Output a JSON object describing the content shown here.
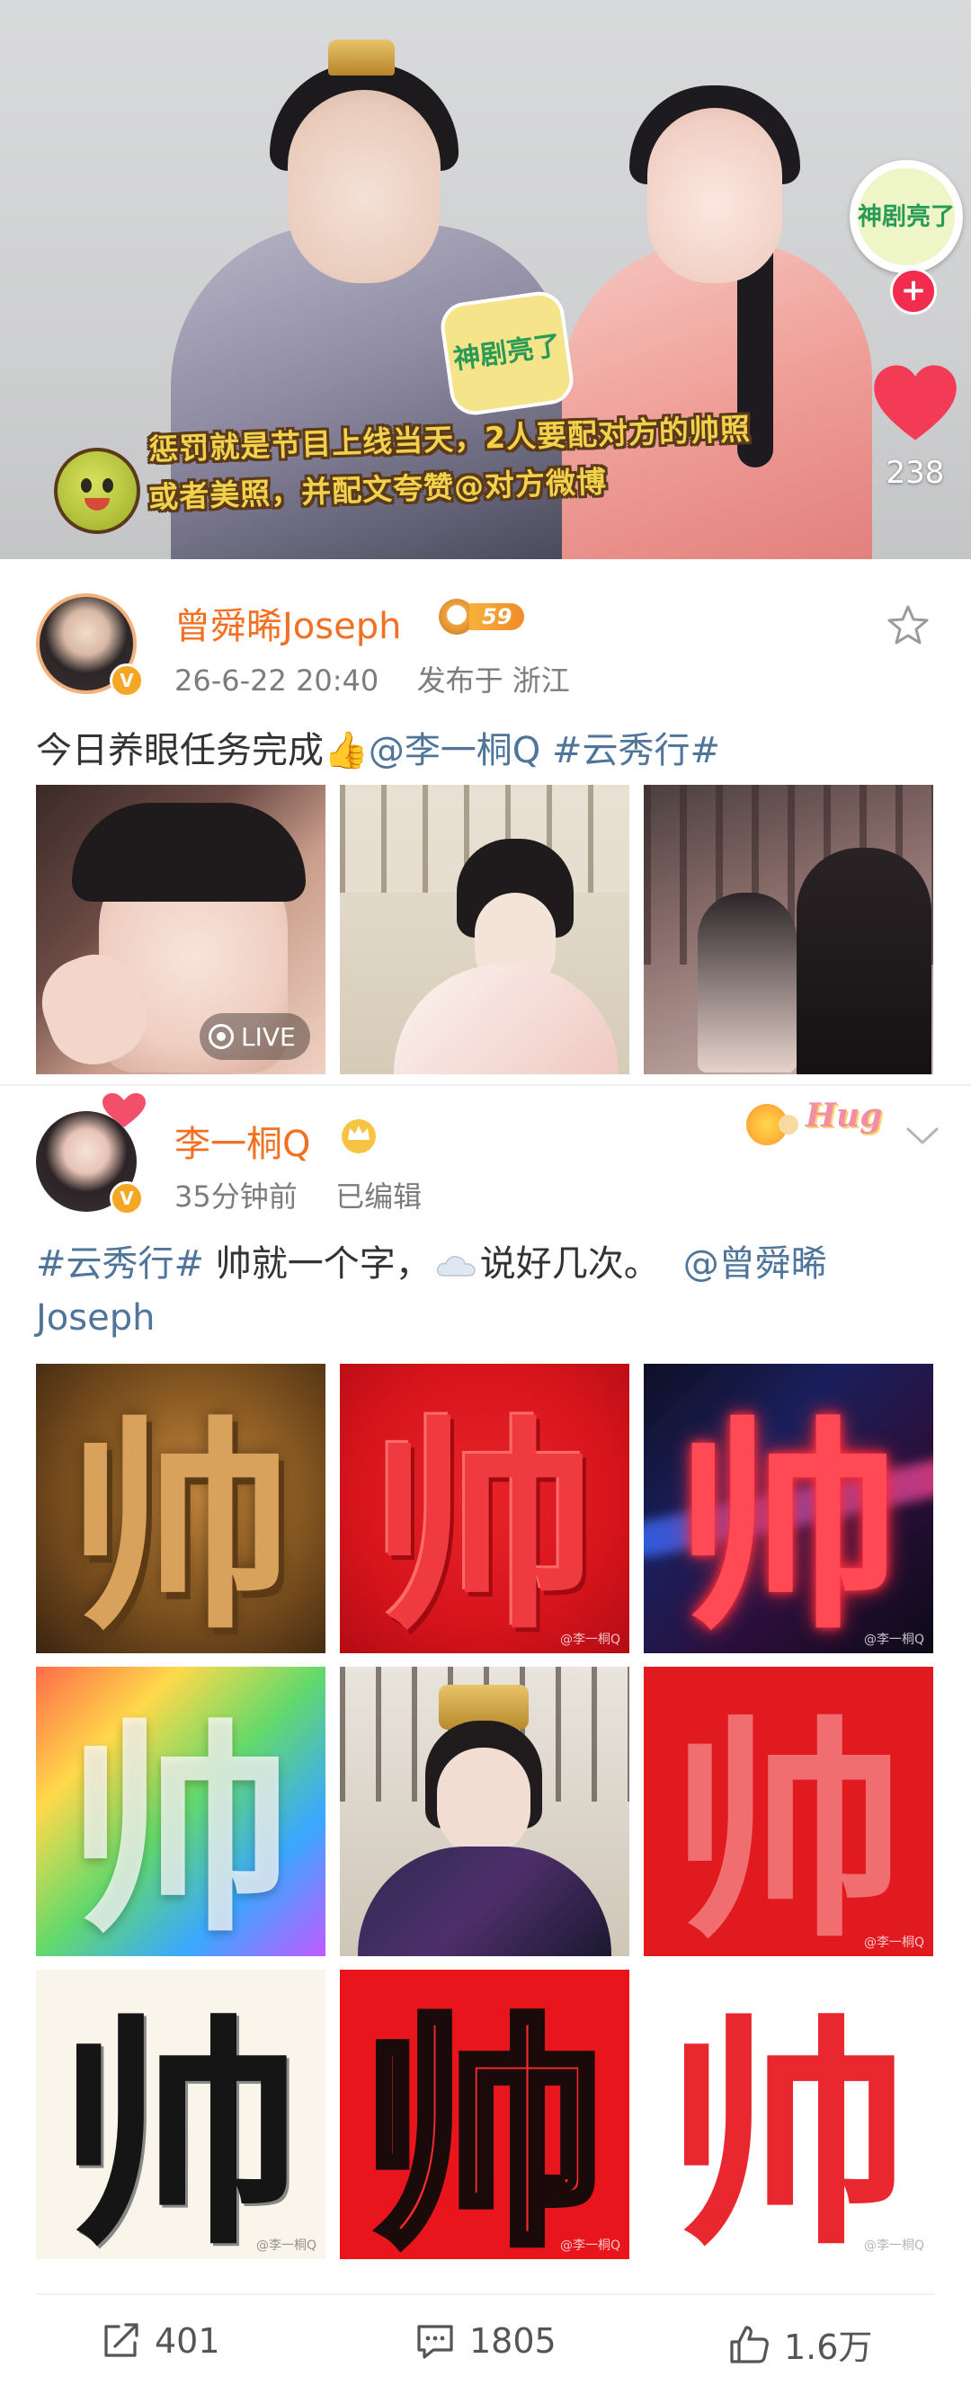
{
  "video": {
    "caption_line1": "惩罚就是节目上线当天，2人要配对方的帅照",
    "caption_line2": "或者美照，并配文夸赞@对方微博",
    "show_logo": "神剧亮了",
    "like_count": "238"
  },
  "post1": {
    "username": "曾舜晞Joseph",
    "level_badge": "59",
    "time": "26-6-22 20:40",
    "location": "发布于 浙江",
    "text_main": "今日养眼任务完成👍",
    "mention": "@李一桐Q",
    "hashtag": "#云秀行#",
    "live_label": "LIVE"
  },
  "post2": {
    "username": "李一桐Q",
    "time": "35分钟前",
    "edited": "已编辑",
    "hashtag": "#云秀行#",
    "text_mid": " 帅就一个字，",
    "text_after_emoji": "说好几次。",
    "mention_line1": "@曾舜晞",
    "mention_line2": "Joseph",
    "decor_text": "Hug",
    "char": "帅",
    "watermark": "@李一桐Q"
  },
  "actions": {
    "share_count": "401",
    "comment_count": "1805",
    "like_count": "1.6万"
  },
  "colors": {
    "username_orange": "#f36f21",
    "link_blue": "#50759b",
    "like_red": "#f22c4f"
  }
}
